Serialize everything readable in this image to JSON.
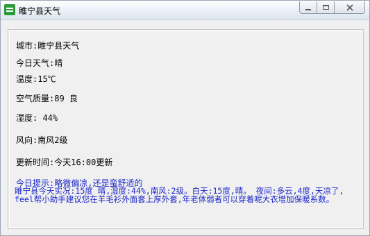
{
  "window": {
    "title": "睢宁县天气",
    "minimize_label": "",
    "maximize_label": ""
  },
  "weather": {
    "city": "城市:睢宁县天气",
    "today": "今日天气:晴",
    "temperature": "温度:15℃",
    "air_quality": "空气质量:89 良",
    "humidity": "湿度: 44%",
    "wind": "风向:南风2级",
    "updated": "更新时间:今天16:00更新"
  },
  "tip": {
    "hint": "今日提示:略微偏凉,还是蛮舒适的",
    "detail": "睢宁县今天实况:15度 晴,湿度:44%,南风:2级。白天:15度,晴。 夜间:多云,4度,天凉了,feel帮小助手建议您在羊毛衫外面套上厚外套,年老体弱者可以穿着呢大衣增加保暖系数。"
  },
  "colors": {
    "tip_blue": "#1b26c9",
    "close_red": "#c0392b"
  }
}
